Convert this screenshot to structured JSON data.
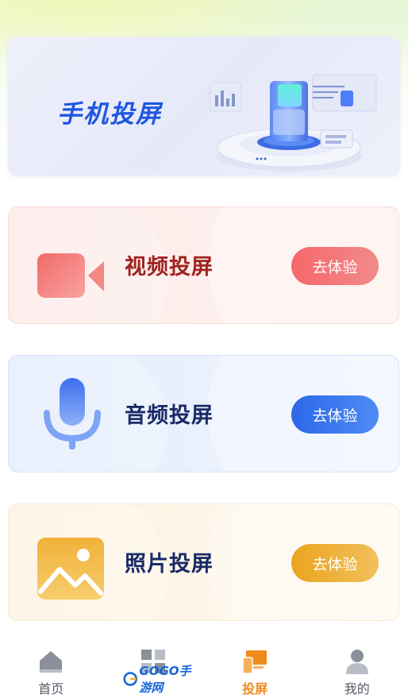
{
  "banner": {
    "title": "手机投屏"
  },
  "cards": [
    {
      "label": "视频投屏",
      "button": "去体验",
      "icon": "video-camera-icon",
      "accent": "#f7676a"
    },
    {
      "label": "音频投屏",
      "button": "去体验",
      "icon": "microphone-icon",
      "accent": "#2d67ea"
    },
    {
      "label": "照片投屏",
      "button": "去体验",
      "icon": "photo-icon",
      "accent": "#eaa41e"
    }
  ],
  "tabbar": {
    "items": [
      {
        "label": "首页",
        "icon": "home-icon",
        "active": false
      },
      {
        "label": "",
        "icon": "grid-icon",
        "active": false
      },
      {
        "label": "投屏",
        "icon": "screencast-icon",
        "active": true
      },
      {
        "label": "我的",
        "icon": "profile-icon",
        "active": false
      }
    ],
    "active_color": "#f08a1c"
  },
  "watermark": {
    "text": "GOGO手游网"
  }
}
